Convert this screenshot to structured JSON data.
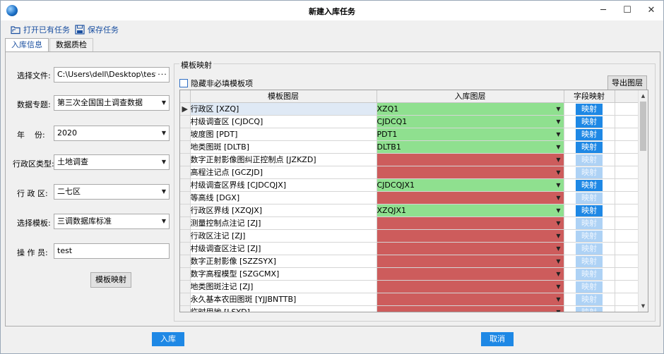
{
  "window": {
    "title": "新建入库任务",
    "minimize": "─",
    "maximize": "☐",
    "close": "✕"
  },
  "toolbar": {
    "open_label": "打开已有任务",
    "save_label": "保存任务"
  },
  "tabs": [
    {
      "label": "入库信息"
    },
    {
      "label": "数据质检"
    }
  ],
  "form": {
    "file_label": "选择文件:",
    "file_value": "C:\\Users\\dell\\Desktop\\testData...",
    "file_browse": "···",
    "topic_label": "数据专题:",
    "topic_value": "第三次全国国土调查数据",
    "year_label": "年    份:",
    "year_value": "2020",
    "district_type_label": "行政区类型:",
    "district_type_value": "土地调查",
    "district_label": "行 政 区:",
    "district_value": "二七区",
    "template_label": "选择模板:",
    "template_value": "三调数据库标准",
    "operator_label": "操 作 员:",
    "operator_value": "test",
    "template_map_button": "模板映射",
    "caret": "▼"
  },
  "mapping": {
    "group_title": "模板映射",
    "hide_optional_label": "隐藏非必填模板项",
    "export_button": "导出图层",
    "columns": {
      "template_layer": "模板图层",
      "storage_layer": "入库图层",
      "field_mapping": "字段映射"
    },
    "row_marker": "▶",
    "rows": [
      {
        "template": "行政区 [XZQ]",
        "target": "XZQ1",
        "ok": true,
        "map": "映射"
      },
      {
        "template": "村级调查区 [CJDCQ]",
        "target": "CJDCQ1",
        "ok": true,
        "map": "映射"
      },
      {
        "template": "坡度图 [PDT]",
        "target": "PDT1",
        "ok": true,
        "map": "映射"
      },
      {
        "template": "地类图斑 [DLTB]",
        "target": "DLTB1",
        "ok": true,
        "map": "映射"
      },
      {
        "template": "数字正射影像图纠正控制点 [JZKZD]",
        "target": "",
        "ok": false,
        "map": "映射"
      },
      {
        "template": "高程注记点 [GCZJD]",
        "target": "",
        "ok": false,
        "map": "映射"
      },
      {
        "template": "村级调查区界线 [CJDCQJX]",
        "target": "CJDCQJX1",
        "ok": true,
        "map": "映射"
      },
      {
        "template": "等高线 [DGX]",
        "target": "",
        "ok": false,
        "map": "映射"
      },
      {
        "template": "行政区界线 [XZQJX]",
        "target": "XZQJX1",
        "ok": true,
        "map": "映射"
      },
      {
        "template": "测量控制点注记 [ZJ]",
        "target": "",
        "ok": false,
        "map": "映射"
      },
      {
        "template": "行政区注记 [ZJ]",
        "target": "",
        "ok": false,
        "map": "映射"
      },
      {
        "template": "村级调查区注记 [ZJ]",
        "target": "",
        "ok": false,
        "map": "映射"
      },
      {
        "template": "数字正射影像 [SZZSYX]",
        "target": "",
        "ok": false,
        "map": "映射"
      },
      {
        "template": "数字高程模型 [SZGCMX]",
        "target": "",
        "ok": false,
        "map": "映射"
      },
      {
        "template": "地类图斑注记 [ZJ]",
        "target": "",
        "ok": false,
        "map": "映射"
      },
      {
        "template": "永久基本农田图斑 [YJJBNTTB]",
        "target": "",
        "ok": false,
        "map": "映射"
      },
      {
        "template": "临时用地 [LSYD]",
        "target": "",
        "ok": false,
        "map": "映射"
      }
    ],
    "scroll_up": "▲",
    "scroll_down": "▼"
  },
  "footer": {
    "confirm_label": "入库",
    "cancel_label": "取消"
  },
  "colors": {
    "accent": "#1e88e5",
    "mapped": "#8fe08f",
    "unmapped": "#cd5c5c",
    "map_disabled": "#aed2f5"
  }
}
